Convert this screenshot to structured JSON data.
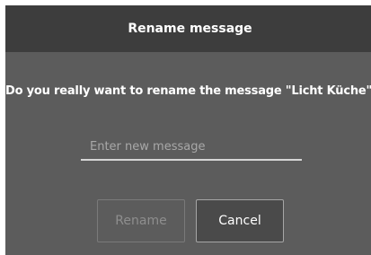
{
  "dialog": {
    "title": "Rename message",
    "question": "Do you really want to rename the message \"Licht Küche\"?",
    "input": {
      "value": "",
      "placeholder": "Enter new message"
    },
    "buttons": {
      "rename_label": "Rename",
      "cancel_label": "Cancel"
    }
  },
  "colors": {
    "header_bg": "#3d3d3d",
    "dialog_bg": "#5c5c5c",
    "text": "#ffffff",
    "disabled_text": "#8e8e8e"
  }
}
